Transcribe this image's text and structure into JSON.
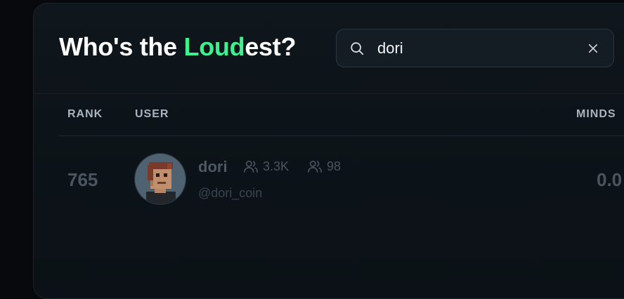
{
  "header": {
    "title_pre": "Who's the ",
    "title_accent": "Loud",
    "title_post": "est?",
    "accent_color": "#3ef08e"
  },
  "search": {
    "value": "dori",
    "icon": "search-icon",
    "clear_icon": "close-icon"
  },
  "table": {
    "columns": [
      "RANK",
      "USER",
      "MINDS"
    ],
    "rows": [
      {
        "rank": "765",
        "username": "dori",
        "followers": "3.3K",
        "following": "98",
        "handle": "@dori_coin",
        "mindshare": "0.0"
      }
    ]
  }
}
